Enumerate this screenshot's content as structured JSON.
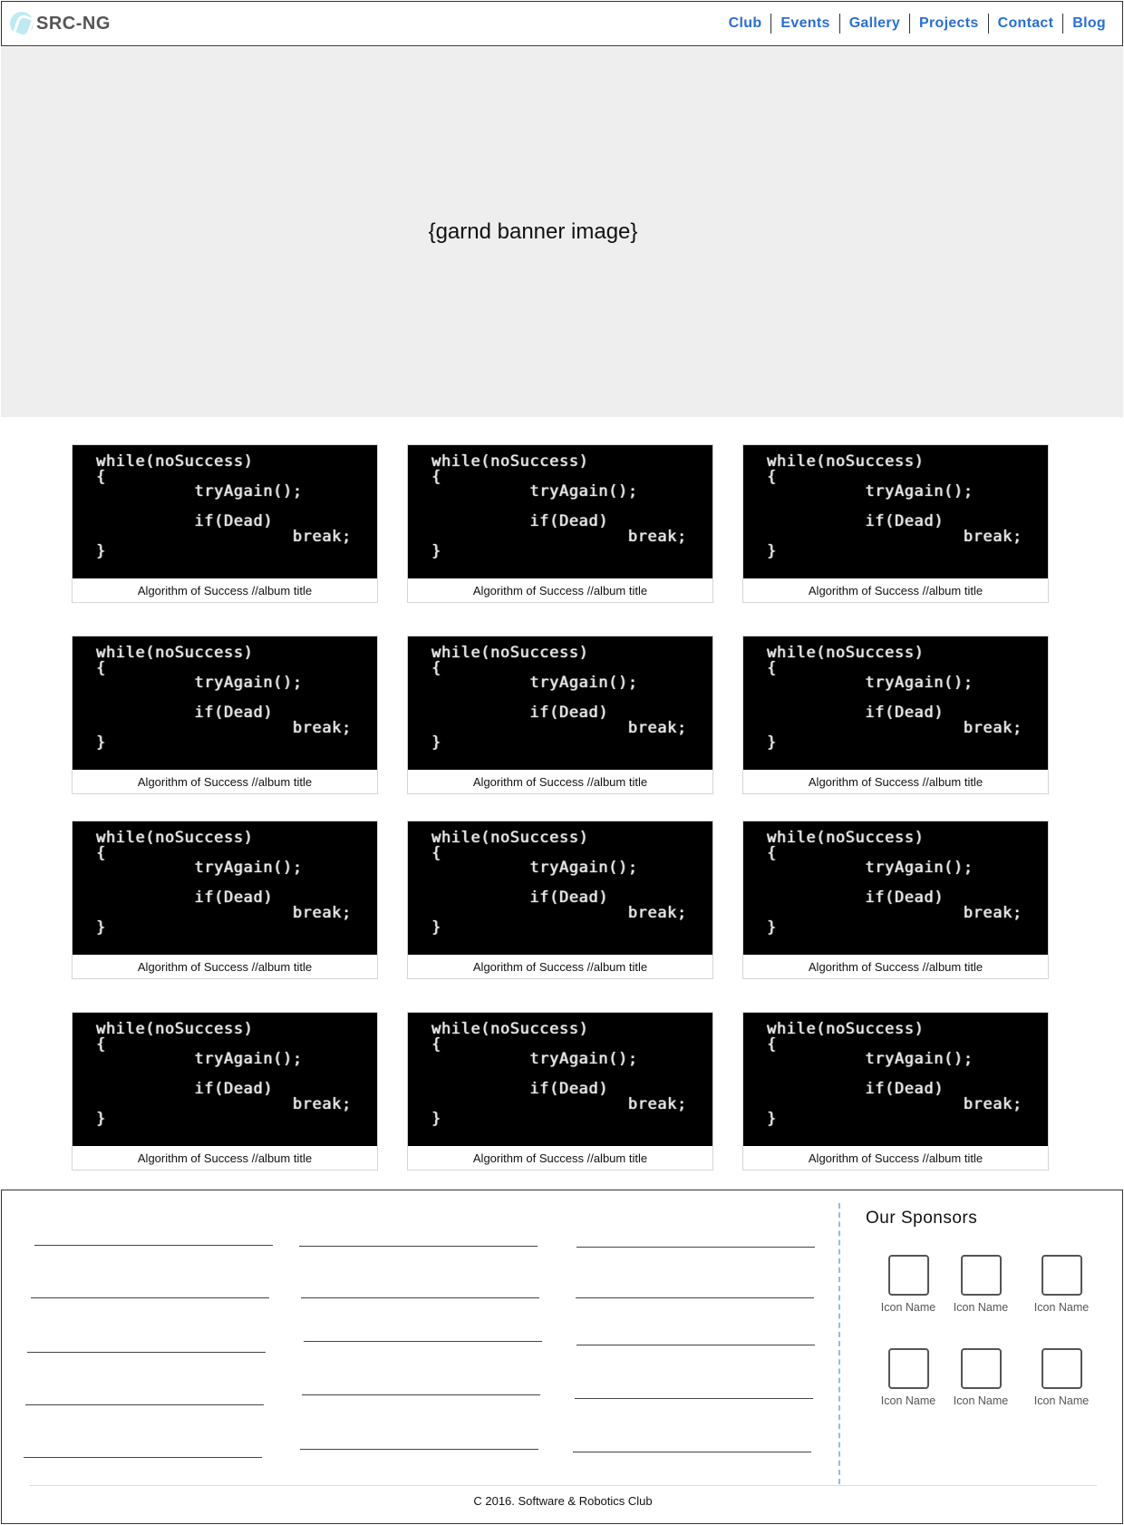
{
  "header": {
    "brand": "SRC-NG",
    "nav": [
      "Club",
      "Events",
      "Gallery",
      "Projects",
      "Contact",
      "Blog"
    ]
  },
  "banner": {
    "text": "{garnd banner image}"
  },
  "albums": [
    {
      "code": "while(noSuccess)\n{\n          tryAgain();\n\n          if(Dead)\n                    break;\n}",
      "title": "Algorithm of Success //album title"
    },
    {
      "code": "while(noSuccess)\n{\n          tryAgain();\n\n          if(Dead)\n                    break;\n}",
      "title": "Algorithm of Success //album title"
    },
    {
      "code": "while(noSuccess)\n{\n          tryAgain();\n\n          if(Dead)\n                    break;\n}",
      "title": "Algorithm of Success //album title"
    },
    {
      "code": "while(noSuccess)\n{\n          tryAgain();\n\n          if(Dead)\n                    break;\n}",
      "title": "Algorithm of Success //album title"
    },
    {
      "code": "while(noSuccess)\n{\n          tryAgain();\n\n          if(Dead)\n                    break;\n}",
      "title": "Algorithm of Success //album title"
    },
    {
      "code": "while(noSuccess)\n{\n          tryAgain();\n\n          if(Dead)\n                    break;\n}",
      "title": "Algorithm of Success //album title"
    },
    {
      "code": "while(noSuccess)\n{\n          tryAgain();\n\n          if(Dead)\n                    break;\n}",
      "title": "Algorithm of Success //album title"
    },
    {
      "code": "while(noSuccess)\n{\n          tryAgain();\n\n          if(Dead)\n                    break;\n}",
      "title": "Algorithm of Success //album title"
    },
    {
      "code": "while(noSuccess)\n{\n          tryAgain();\n\n          if(Dead)\n                    break;\n}",
      "title": "Algorithm of Success //album title"
    },
    {
      "code": "while(noSuccess)\n{\n          tryAgain();\n\n          if(Dead)\n                    break;\n}",
      "title": "Algorithm of Success //album title"
    },
    {
      "code": "while(noSuccess)\n{\n          tryAgain();\n\n          if(Dead)\n                    break;\n}",
      "title": "Algorithm of Success //album title"
    },
    {
      "code": "while(noSuccess)\n{\n          tryAgain();\n\n          if(Dead)\n                    break;\n}",
      "title": "Algorithm of Success //album title"
    }
  ],
  "footer": {
    "sponsors_title": "Our Sponsors",
    "sponsors": [
      "Icon Name",
      "Icon Name",
      "Icon Name",
      "Icon Name",
      "Icon Name",
      "Icon Name"
    ],
    "copyright": "C 2016. Software & Robotics Club"
  }
}
